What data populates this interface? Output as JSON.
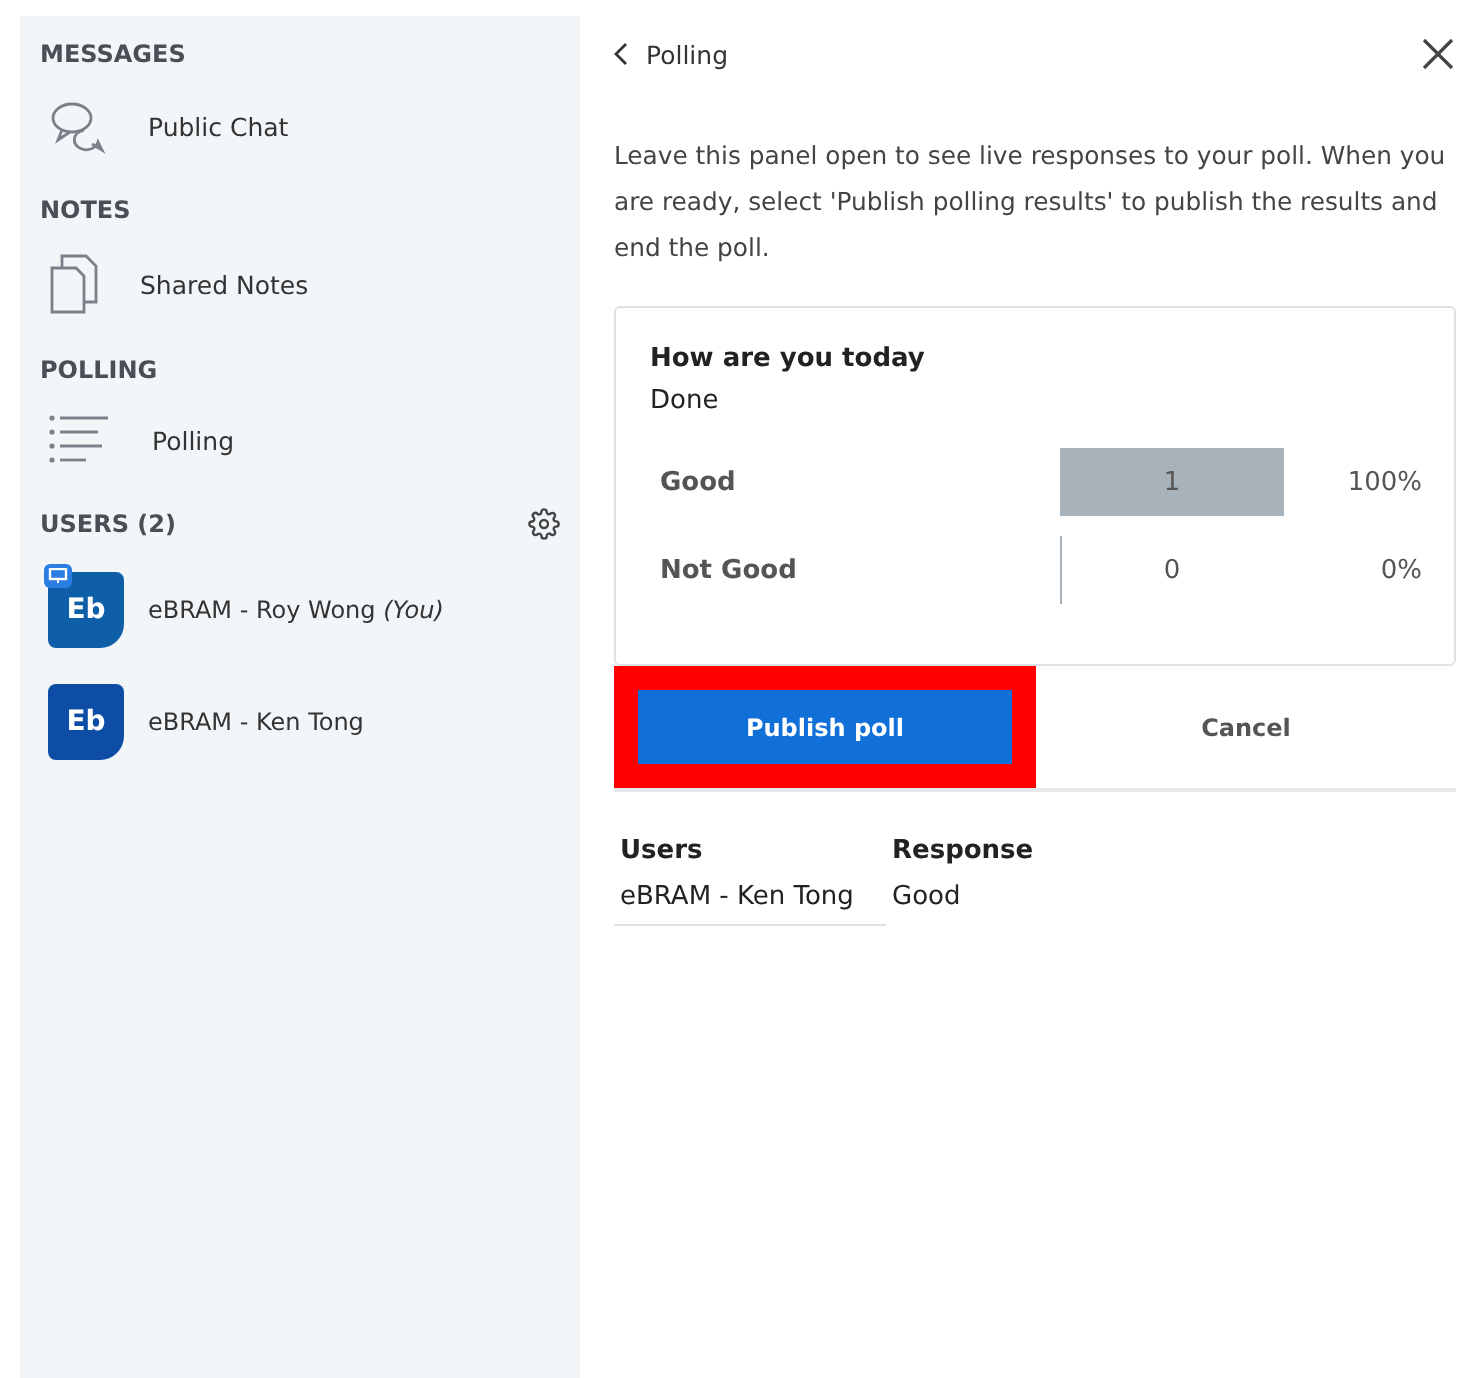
{
  "sidebar": {
    "sections": [
      {
        "title": "MESSAGES",
        "items": [
          {
            "kind": "chat",
            "label": "Public Chat"
          }
        ]
      },
      {
        "title": "NOTES",
        "items": [
          {
            "kind": "notes",
            "label": "Shared Notes"
          }
        ]
      },
      {
        "title": "POLLING",
        "items": [
          {
            "kind": "poll",
            "label": "Polling"
          }
        ]
      }
    ],
    "users": {
      "title": "USERS (2)",
      "list": [
        {
          "initials": "Eb",
          "name": "eBRAM - Roy Wong",
          "you": "(You)",
          "presenter": true,
          "color": "#0f5ea8"
        },
        {
          "initials": "Eb",
          "name": "eBRAM - Ken Tong",
          "presenter": false,
          "color": "#0d4da6"
        }
      ]
    }
  },
  "panel": {
    "back": "Polling",
    "intro": "Leave this panel open to see live responses to your poll. When you are ready, select 'Publish polling results' to publish the results and end the poll.",
    "poll": {
      "question": "How are you today",
      "status": "Done",
      "answers": [
        {
          "label": "Good",
          "count": "1",
          "percent": "100%"
        },
        {
          "label": "Not Good",
          "count": "0",
          "percent": "0%"
        }
      ]
    },
    "publish": {
      "label": "Publish poll",
      "highlighted": true
    },
    "cancel": "Cancel",
    "responses": {
      "columns": [
        "Users",
        "Response"
      ],
      "rows": [
        [
          "eBRAM - Ken Tong",
          "Good"
        ]
      ]
    }
  }
}
